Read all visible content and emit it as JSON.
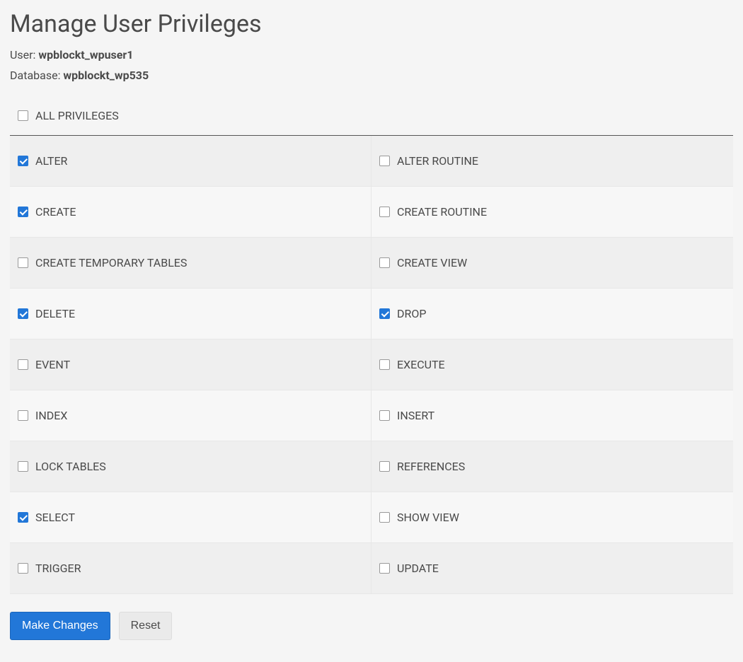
{
  "title": "Manage User Privileges",
  "user_label": "User: ",
  "user_value": "wpblockt_wpuser1",
  "database_label": "Database: ",
  "database_value": "wpblockt_wp535",
  "all_privileges": {
    "label": "ALL PRIVILEGES",
    "checked": false
  },
  "privileges": [
    [
      {
        "label": "ALTER",
        "checked": true
      },
      {
        "label": "ALTER ROUTINE",
        "checked": false
      }
    ],
    [
      {
        "label": "CREATE",
        "checked": true
      },
      {
        "label": "CREATE ROUTINE",
        "checked": false
      }
    ],
    [
      {
        "label": "CREATE TEMPORARY TABLES",
        "checked": false
      },
      {
        "label": "CREATE VIEW",
        "checked": false
      }
    ],
    [
      {
        "label": "DELETE",
        "checked": true
      },
      {
        "label": "DROP",
        "checked": true
      }
    ],
    [
      {
        "label": "EVENT",
        "checked": false
      },
      {
        "label": "EXECUTE",
        "checked": false
      }
    ],
    [
      {
        "label": "INDEX",
        "checked": false
      },
      {
        "label": "INSERT",
        "checked": false
      }
    ],
    [
      {
        "label": "LOCK TABLES",
        "checked": false
      },
      {
        "label": "REFERENCES",
        "checked": false
      }
    ],
    [
      {
        "label": "SELECT",
        "checked": true
      },
      {
        "label": "SHOW VIEW",
        "checked": false
      }
    ],
    [
      {
        "label": "TRIGGER",
        "checked": false
      },
      {
        "label": "UPDATE",
        "checked": false
      }
    ]
  ],
  "actions": {
    "make_changes": "Make Changes",
    "reset": "Reset"
  }
}
